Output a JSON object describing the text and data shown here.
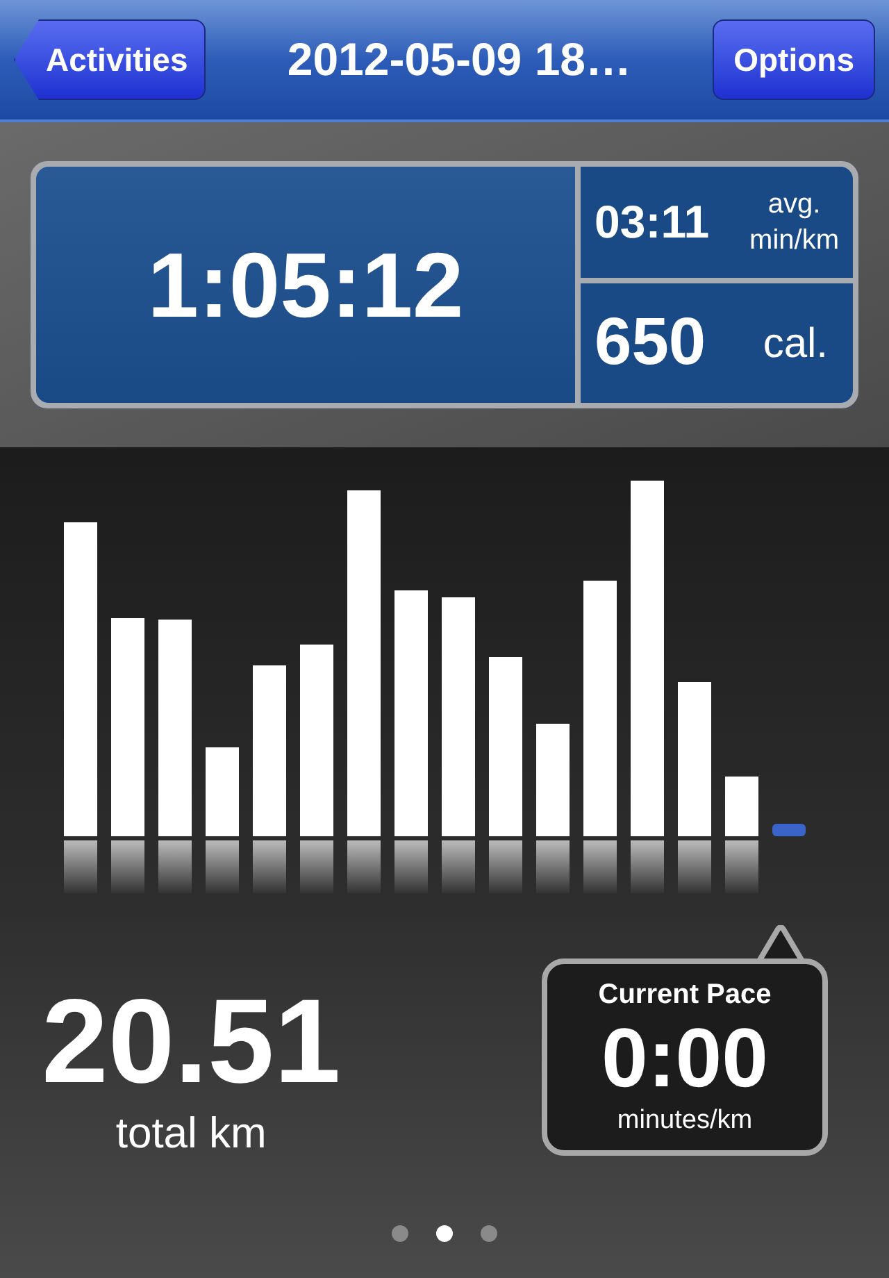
{
  "nav_bar": {
    "back_button": "Activities",
    "title": "2012-05-09 18…",
    "options_button": "Options"
  },
  "stats": {
    "duration": "1:05:12",
    "pace": {
      "value": "03:11",
      "unit_line_1": "avg.",
      "unit_line_2": "min/km"
    },
    "calories": {
      "value": "650",
      "unit": "cal."
    }
  },
  "distance": {
    "value": "20.51",
    "label": "total km"
  },
  "current_pace": {
    "title": "Current Pace",
    "value": "0:00",
    "unit": "minutes/km"
  },
  "page_dots": [
    {
      "selected": false
    },
    {
      "selected": true
    },
    {
      "selected": false
    }
  ]
}
